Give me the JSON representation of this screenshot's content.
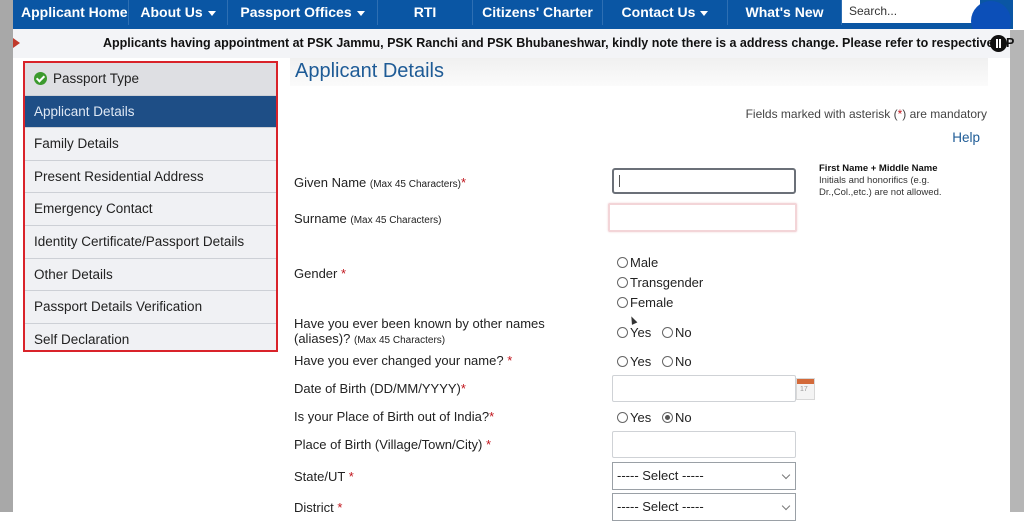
{
  "nav": {
    "items": [
      {
        "label": "Applicant Home",
        "dropdown": false
      },
      {
        "label": "About Us",
        "dropdown": true
      },
      {
        "label": "Passport Offices",
        "dropdown": true
      },
      {
        "label": "RTI",
        "dropdown": false
      },
      {
        "label": "Citizens' Charter",
        "dropdown": false
      },
      {
        "label": "Contact Us",
        "dropdown": true
      },
      {
        "label": "What's New",
        "dropdown": false
      }
    ],
    "search_placeholder": "Search..."
  },
  "ticker": {
    "text": "Applicants having appointment at PSK Jammu, PSK Ranchi and PSK Bhubaneshwar, kindly note there is a address change. Please refer to respective RP"
  },
  "sidebar": {
    "items": [
      {
        "label": "Passport Type",
        "state": "completed"
      },
      {
        "label": "Applicant Details",
        "state": "active"
      },
      {
        "label": "Family Details",
        "state": "pending"
      },
      {
        "label": "Present Residential Address",
        "state": "pending"
      },
      {
        "label": "Emergency Contact",
        "state": "pending"
      },
      {
        "label": "Identity Certificate/Passport Details",
        "state": "pending"
      },
      {
        "label": "Other Details",
        "state": "pending"
      },
      {
        "label": "Passport Details Verification",
        "state": "pending"
      },
      {
        "label": "Self Declaration",
        "state": "pending"
      }
    ]
  },
  "colors": {
    "nav": "#0a56a4",
    "active": "#1e4e86",
    "highlight_border": "#d9232a",
    "required": "#c0141c"
  },
  "main": {
    "title": "Applicant Details",
    "mandatory_pre": "Fields marked with asterisk (",
    "mandatory_star": "*",
    "mandatory_post": ") are mandatory",
    "help": "Help",
    "given_name": {
      "label": "Given Name",
      "note": "(Max 45 Characters)",
      "required": "*",
      "value": ""
    },
    "given_name_hint": {
      "title": "First Name + Middle Name",
      "line1": "Initials and honorifics (e.g.",
      "line2": "Dr.,Col.,etc.) are not allowed."
    },
    "surname": {
      "label": "Surname",
      "note": "(Max 45 Characters)",
      "value": ""
    },
    "gender": {
      "label": "Gender",
      "required": "*",
      "options": [
        "Male",
        "Transgender",
        "Female"
      ],
      "selected": null
    },
    "aliases": {
      "label_line1": "Have you ever been known by other names",
      "label_line2": "(aliases)?",
      "note": "(Max 45 Characters)",
      "options": [
        "Yes",
        "No"
      ],
      "selected": null
    },
    "changed_name": {
      "label": "Have you ever changed your name?",
      "required": "*",
      "options": [
        "Yes",
        "No"
      ],
      "selected": null
    },
    "dob": {
      "label": "Date of Birth (DD/MM/YYYY)",
      "required": "*",
      "value": "",
      "calendar_text": "17"
    },
    "pob_outside": {
      "label": "Is your Place of Birth out of India?",
      "required": "*",
      "options": [
        "Yes",
        "No"
      ],
      "selected": "No"
    },
    "place_of_birth": {
      "label": "Place of Birth (Village/Town/City)",
      "required": "*",
      "value": ""
    },
    "state": {
      "label": "State/UT",
      "required": "*",
      "selected": "----- Select -----"
    },
    "district": {
      "label": "District",
      "required": "*",
      "selected": "----- Select -----"
    }
  }
}
